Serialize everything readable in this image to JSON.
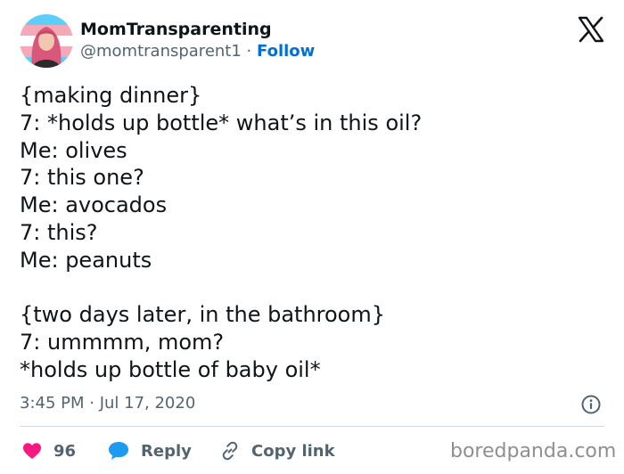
{
  "tweet": {
    "author_name": "MomTransparenting",
    "author_handle": "@momtransparent1",
    "separator": "·",
    "follow_label": "Follow",
    "lines": [
      "{making dinner}",
      "7: *holds up bottle* what’s in this oil?",
      "Me: olives",
      "7: this one?",
      "Me: avocados",
      "7: this?",
      "Me: peanuts",
      "",
      "{two days later, in the bathroom}",
      "7: ummmm, mom?",
      "*holds up bottle of baby oil*"
    ],
    "timestamp": "3:45 PM · Jul 17, 2020"
  },
  "actions": {
    "like_count": "96",
    "reply_label": "Reply",
    "copy_link_label": "Copy link"
  },
  "watermark": "boredpanda.com",
  "icons": {
    "logo": "x-logo-icon",
    "info": "info-icon",
    "like": "heart-icon",
    "reply": "speech-bubble-icon",
    "copy": "link-icon"
  },
  "colors": {
    "text": "#0f1419",
    "secondary": "#536471",
    "follow": "#006fd6",
    "like": "#f91880",
    "reply": "#1d9bf0",
    "divider": "#cfd9de"
  }
}
